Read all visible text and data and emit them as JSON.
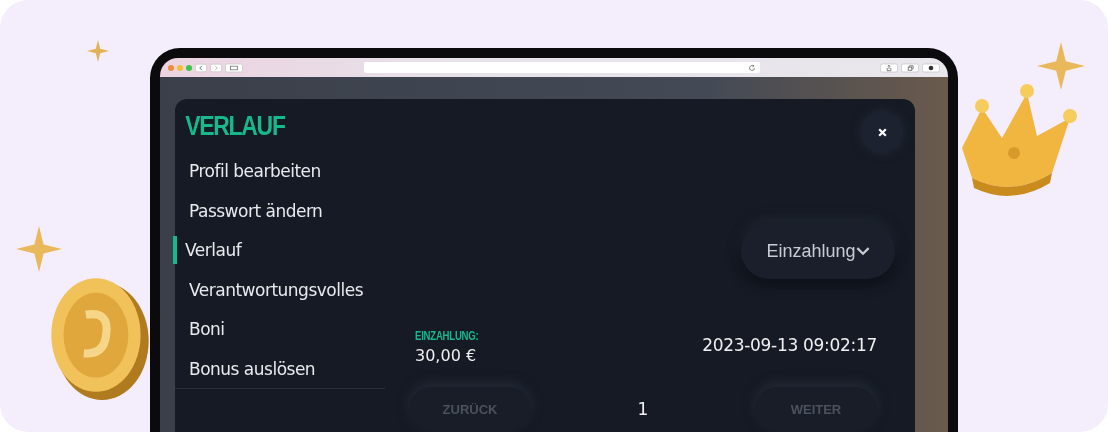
{
  "modal": {
    "title": "VERLAUF",
    "menu": [
      {
        "label": "Profil bearbeiten",
        "selected": false
      },
      {
        "label": "Passwort ändern",
        "selected": false
      },
      {
        "label": "Verlauf",
        "selected": true
      },
      {
        "label": "Verantwortungsvolles",
        "selected": false
      },
      {
        "label": "Boni",
        "selected": false
      },
      {
        "label": "Bonus auslösen",
        "selected": false
      }
    ],
    "filter": {
      "value": "Einzahlung"
    },
    "transactions": [
      {
        "label": "EINZAHLUNG:",
        "amount": "30,00 €",
        "date": "2023-09-13 09:02:17"
      }
    ],
    "pagination": {
      "previous": {
        "label": "ZURÜCK",
        "disabled": true
      },
      "page": "1",
      "next": {
        "label": "WEITER",
        "disabled": true
      }
    }
  }
}
